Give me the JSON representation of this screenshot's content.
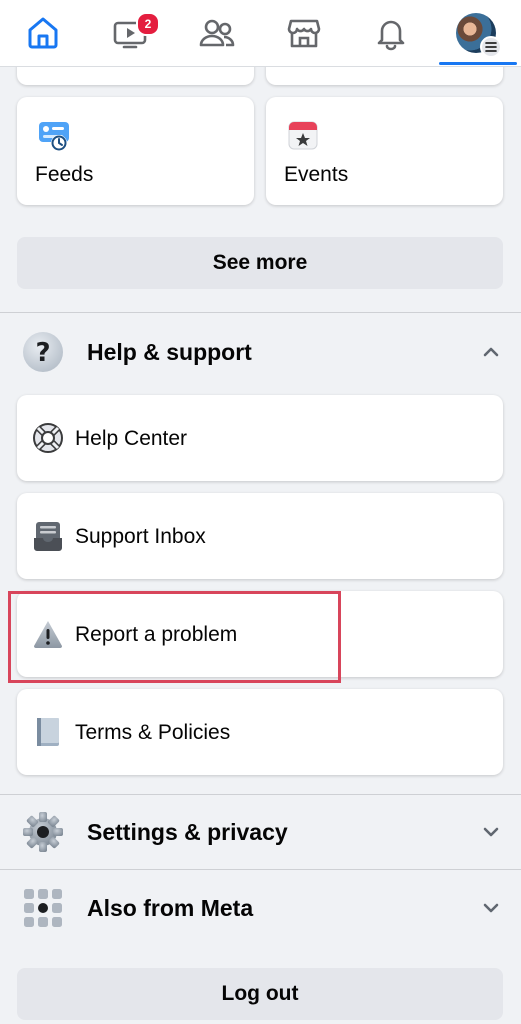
{
  "top_nav": {
    "tabs": [
      {
        "name": "home-icon",
        "active": false
      },
      {
        "name": "video-icon",
        "badge": "2"
      },
      {
        "name": "friends-icon"
      },
      {
        "name": "marketplace-icon"
      },
      {
        "name": "notifications-icon"
      },
      {
        "name": "profile-menu-avatar",
        "active": true
      }
    ],
    "video_badge": "2",
    "accent_color": "#1877f2"
  },
  "shortcuts": [
    {
      "label": "Feeds",
      "icon": "feeds-icon"
    },
    {
      "label": "Events",
      "icon": "calendar-star-icon"
    }
  ],
  "see_more_label": "See more",
  "help_support": {
    "title": "Help & support",
    "expanded": true,
    "items": [
      {
        "label": "Help Center",
        "icon": "lifebuoy-icon"
      },
      {
        "label": "Support Inbox",
        "icon": "inbox-tray-icon"
      },
      {
        "label": "Report a problem",
        "icon": "warning-icon",
        "highlighted": true
      },
      {
        "label": "Terms & Policies",
        "icon": "book-icon"
      }
    ]
  },
  "settings_privacy": {
    "title": "Settings & privacy",
    "expanded": false
  },
  "also_from_meta": {
    "title": "Also from Meta",
    "expanded": false
  },
  "logout_label": "Log out",
  "highlight_color": "#d8455b"
}
